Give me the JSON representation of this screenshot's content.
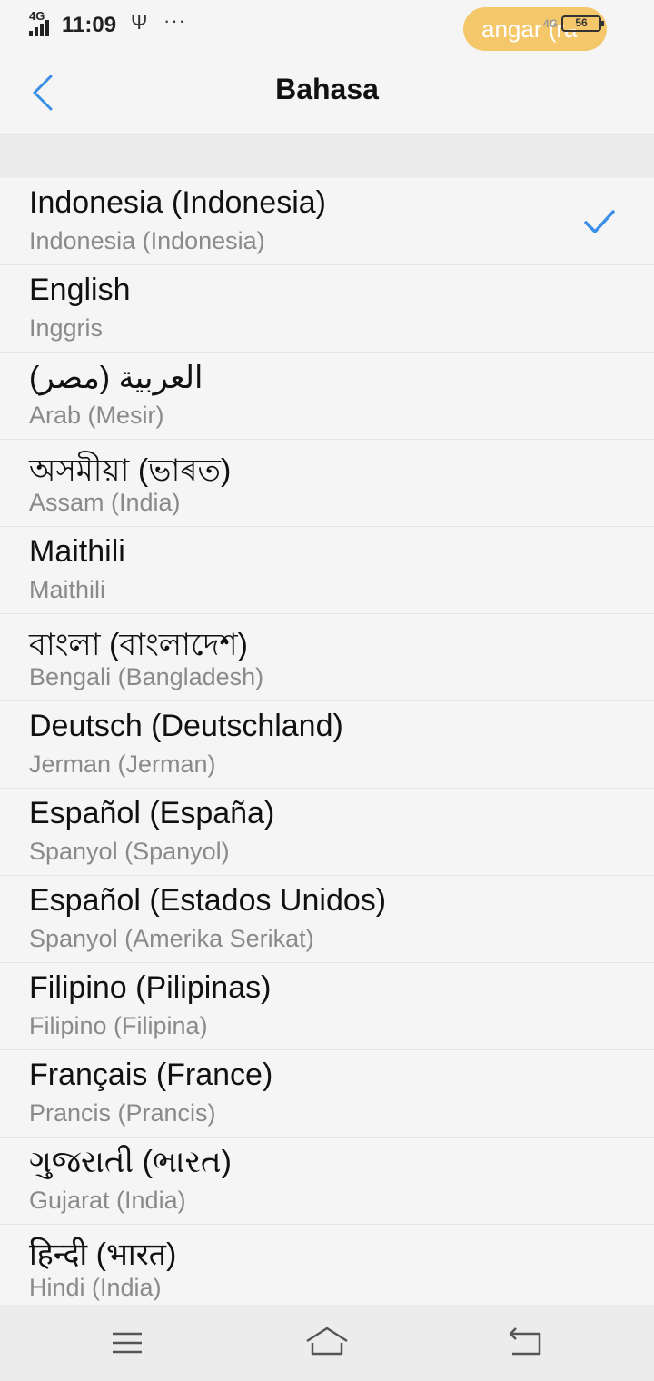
{
  "status_bar": {
    "network": "4G",
    "time": "11:09",
    "notification_pill": "angar (ra",
    "network_right": "4G",
    "battery_level": "56"
  },
  "header": {
    "title": "Bahasa"
  },
  "languages": [
    {
      "name": "Indonesia (Indonesia)",
      "subtitle": "Indonesia (Indonesia)",
      "selected": true
    },
    {
      "name": "English",
      "subtitle": "Inggris",
      "selected": false
    },
    {
      "name": "العربية (مصر)",
      "subtitle": "Arab (Mesir)",
      "selected": false
    },
    {
      "name": "অসমীয়া (ভাৰত)",
      "subtitle": "Assam (India)",
      "selected": false
    },
    {
      "name": "Maithili",
      "subtitle": "Maithili",
      "selected": false
    },
    {
      "name": "বাংলা (বাংলাদেশ)",
      "subtitle": "Bengali (Bangladesh)",
      "selected": false
    },
    {
      "name": "Deutsch (Deutschland)",
      "subtitle": "Jerman (Jerman)",
      "selected": false
    },
    {
      "name": "Español (España)",
      "subtitle": "Spanyol (Spanyol)",
      "selected": false
    },
    {
      "name": "Español (Estados Unidos)",
      "subtitle": "Spanyol (Amerika Serikat)",
      "selected": false
    },
    {
      "name": "Filipino (Pilipinas)",
      "subtitle": "Filipino (Filipina)",
      "selected": false
    },
    {
      "name": "Français (France)",
      "subtitle": "Prancis (Prancis)",
      "selected": false
    },
    {
      "name": "ગુજરાતી (ભારત)",
      "subtitle": "Gujarat (India)",
      "selected": false
    },
    {
      "name": "हिन्दी (भारत)",
      "subtitle": "Hindi (India)",
      "selected": false
    }
  ],
  "colors": {
    "accent": "#3a8ee6",
    "pill": "#f4c86a",
    "background": "#f5f5f5",
    "secondary_text": "#8a8a8a"
  },
  "icons": {
    "back": "chevron-left-icon",
    "check": "checkmark-icon",
    "menu": "menu-icon",
    "home": "home-icon",
    "return": "back-arrow-icon"
  }
}
